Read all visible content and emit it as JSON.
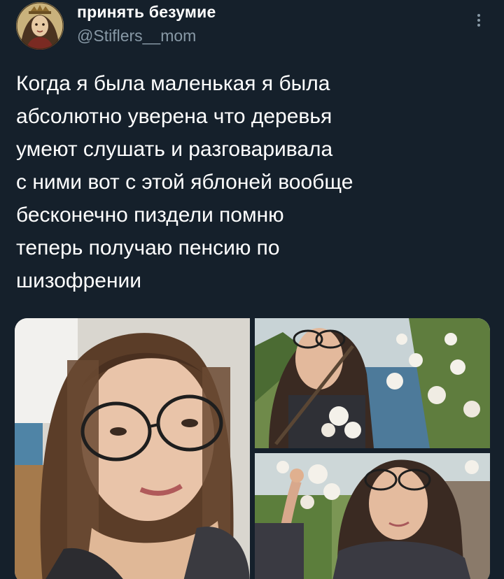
{
  "author": {
    "display_name": "принять безумие",
    "handle": "@Stiflers__mom",
    "avatar_icon": "avatar-portrait-icon"
  },
  "menu": {
    "icon": "more-vertical-icon"
  },
  "tweet": {
    "lines": [
      "Когда я была маленькая я была",
      "абсолютно уверена что деревья",
      "умеют слушать и разговаривала",
      "с ними вот с этой яблоней вообще",
      "бесконечно пиздели помню",
      "теперь получаю пенсию по",
      "шизофрении"
    ]
  },
  "colors": {
    "background": "#15202b",
    "text_primary": "#ffffff",
    "text_secondary": "#8899a6"
  }
}
